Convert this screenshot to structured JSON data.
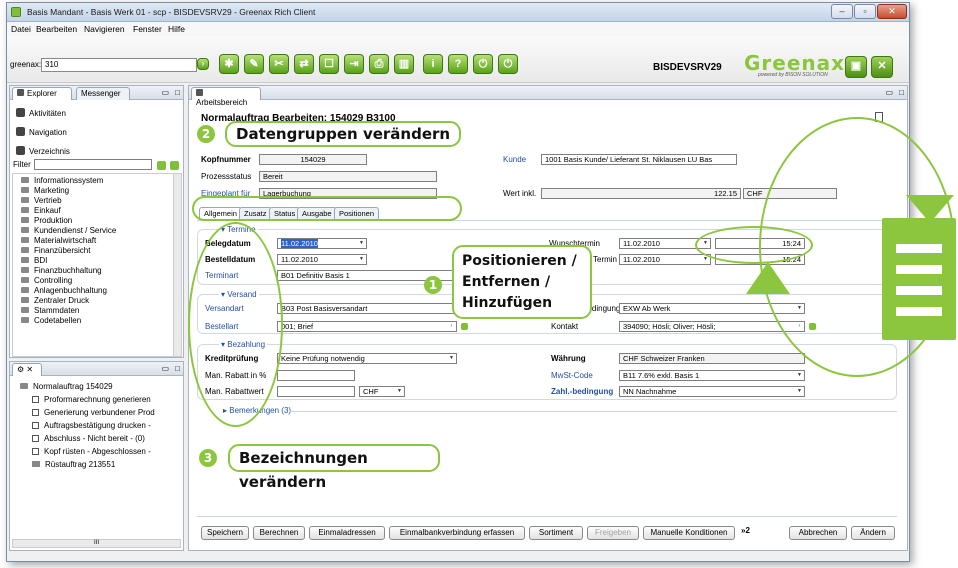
{
  "window": {
    "title": "Basis Mandant - Basis Werk 01 - scp - BISDEVSRV29 - Greenax Rich Client",
    "controls": [
      "–",
      "▫",
      "✕"
    ]
  },
  "menu": [
    "Datei",
    "Bearbeiten",
    "Navigieren",
    "Fenster",
    "Hilfe"
  ],
  "toolbar": {
    "url_prefix": "greenax://",
    "url_value": "310",
    "server": "BISDEVSRV29",
    "logo_text": "Greenax",
    "logo_sub": "powered by BISON SOLUTION",
    "buttons": [
      "✱",
      "✎",
      "✂",
      "⇄",
      "☐",
      "⇥",
      "⎙",
      "▥",
      "i",
      "?",
      "⏻",
      "⏻"
    ]
  },
  "left_panel": {
    "tabs": [
      "Explorer",
      "Messenger"
    ],
    "nav_items": [
      "Aktivitäten",
      "Navigation",
      "Verzeichnis"
    ],
    "filter_label": "Filter",
    "tree_items": [
      "Informationssystem",
      "Marketing",
      "Vertrieb",
      "Einkauf",
      "Produktion",
      "Kundendienst / Service",
      "Materialwirtschaft",
      "Finanzübersicht",
      "BDI",
      "Finanzbuchhaltung",
      "Controlling",
      "Anlagenbuchhaltung",
      "Zentraler Druck",
      "Stammdaten",
      "Codetabellen"
    ]
  },
  "bottom_left_panel": {
    "tab_icon": "⚙",
    "tab_close": "✕",
    "root": "Normalauftrag 154029",
    "leaves": [
      "Proformarechnung generieren",
      "Generierung verbundener Prod",
      "Auftragsbestätigung drucken -",
      "Abschluss - Nicht bereit - (0)",
      "Kopf rüsten - Abgeschlossen -"
    ],
    "last_item": "Rüstauftrag 213551",
    "scroll_mark": "III"
  },
  "workarea": {
    "tab": "Arbeitsbereich",
    "title": "Normalauftrag Bearbeiten: 154029 B3100",
    "kopfnummer_label": "Kopfnummer",
    "kopfnummer_value": "154029",
    "kunde_label": "Kunde",
    "kunde_value": "1001 Basis Kunde/ Lieferant St. Niklausen LU  Bas",
    "prozessstatus_label": "Prozessstatus",
    "prozessstatus_value": "Bereit",
    "eingeplant_label": "Eingeplant für",
    "eingeplant_value": "Lagerbuchung",
    "wert_label": "Wert inkl.",
    "wert_value": "122.15",
    "wert_currency": "CHF",
    "tabs": [
      "Allgemein",
      "Zusatz",
      "Status",
      "Ausgabe",
      "Positionen"
    ],
    "termine_header": "Termine",
    "belegdatum_label": "Belegdatum",
    "belegdatum_value": "11.02.2010",
    "bestelldatum_label": "Bestelldatum",
    "bestelldatum_value": "11.02.2010",
    "terminart_label": "Terminart",
    "terminart_value": "B01 Definitiv Basis 1",
    "wunschtermin_label": "Wunschtermin",
    "wunschtermin_value": "11.02.2010",
    "wunschtermin_time": "15:24",
    "termin2_label": "Termin",
    "termin2_value": "11.02.2010",
    "termin2_time": "15:24",
    "versand_header": "Versand",
    "versandart_label": "Versandart",
    "versandart_value": "B03 Post Basisversandart",
    "lieferbedingung_label": "Lieferbedingung",
    "lieferbedingung_value": "EXW Ab Werk",
    "bestellart_label": "Bestellart",
    "bestellart_value": "001; Brief",
    "kontakt_label": "Kontakt",
    "kontakt_value": "394090; Hösli; Oliver; Hösli;",
    "bezahlung_header": "Bezahlung",
    "kreditpruefung_label": "Kreditprüfung",
    "kreditpruefung_value": "Keine Prüfung notwendig",
    "waehrung_label": "Währung",
    "waehrung_value": "CHF Schweizer Franken",
    "rabatt_prozent_label": "Man. Rabatt in %",
    "mwst_label": "MwSt-Code",
    "mwst_value": "B11 7.6% exkl. Basis 1",
    "rabattwert_label": "Man. Rabattwert",
    "rabattwert_currency": "CHF",
    "zahlbedingung_label": "Zahl.-bedingung",
    "zahlbedingung_value": "NN Nachnahme",
    "bemerkungen_label": "Bemerkungen (3)"
  },
  "footer_buttons": [
    "Speichern",
    "Berechnen",
    "Einmaladressen",
    "Einmalbankverbindung erfassen",
    "Sortiment",
    "Freigeben",
    "Manuelle Konditionen"
  ],
  "footer_more": "»2",
  "footer_right": [
    "Abbrechen",
    "Ändern"
  ],
  "callouts": {
    "c1_num": "1",
    "c1_text": "Positionieren / Entfernen / Hinzufügen",
    "c2_num": "2",
    "c2_text": "Datengruppen verändern",
    "c3_num": "3",
    "c3_text": "Bezeichnungen verändern"
  },
  "accent_color": "#8cc63e"
}
